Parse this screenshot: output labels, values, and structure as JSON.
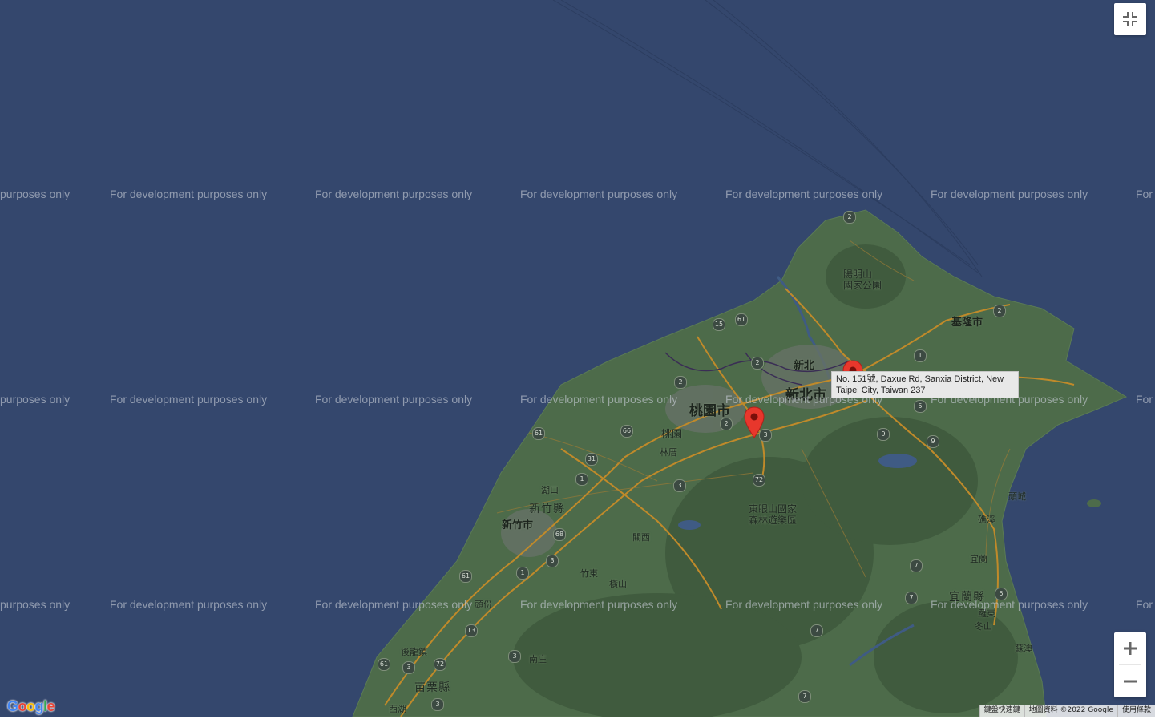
{
  "map": {
    "marker_tooltip": "No. 151號, Daxue Rd, Sanxia District, New Taipei City, Taiwan 237",
    "watermark_text": "For development purposes only",
    "watermark_partial_left": "purposes only",
    "watermark_partial_right": "For",
    "labels": {
      "yangmingshan": "陽明山\n國家公園",
      "keelung": "基隆市",
      "xinbei": "新北",
      "xinbei_city": "新北市",
      "taoyuan_city": "桃園市",
      "taoyuan": "桃園",
      "linzuo": "林厝",
      "hukou": "湖口",
      "hsinchu_county": "新竹縣",
      "hsinchu_city": "新竹市",
      "guanxi": "關西",
      "zhudong": "竹東",
      "hengshan": "橫山",
      "dongyanshan": "東眼山國家\n森林遊樂區",
      "toucheng": "頭城",
      "jiaoxi": "礁溪",
      "yilan_city": "宜蘭",
      "yilan_county": "宜蘭縣",
      "luodong": "羅東",
      "dongshan": "冬山",
      "suao": "蘇澳",
      "houlong": "後龍鎮",
      "miaoli_county": "苗栗縣",
      "nanzhuang": "南庄",
      "xihu": "西湖",
      "touwen": "頭份"
    },
    "route_shields": [
      "2",
      "2",
      "15",
      "61",
      "2",
      "2",
      "3",
      "66",
      "61",
      "31",
      "1",
      "3",
      "72",
      "68",
      "1",
      "3",
      "61",
      "9",
      "9",
      "5",
      "1",
      "2",
      "7",
      "7",
      "5",
      "13",
      "72",
      "61",
      "3",
      "3",
      "7",
      "3",
      "7"
    ]
  },
  "controls": {
    "fullscreen_icon": "exit-fullscreen-icon",
    "zoom_in_symbol": "+",
    "zoom_out_symbol": "−"
  },
  "footer": {
    "google_logo": "Google",
    "keyboard_shortcuts": "鍵盤快速鍵",
    "map_data": "地圖資料 ©2022 Google",
    "terms": "使用條款"
  },
  "colors": {
    "water": "#34476d",
    "land": "#4d6b4a",
    "mountain": "#3f5a3d",
    "highway": "#c08a2a",
    "marker": "#e8372c"
  }
}
